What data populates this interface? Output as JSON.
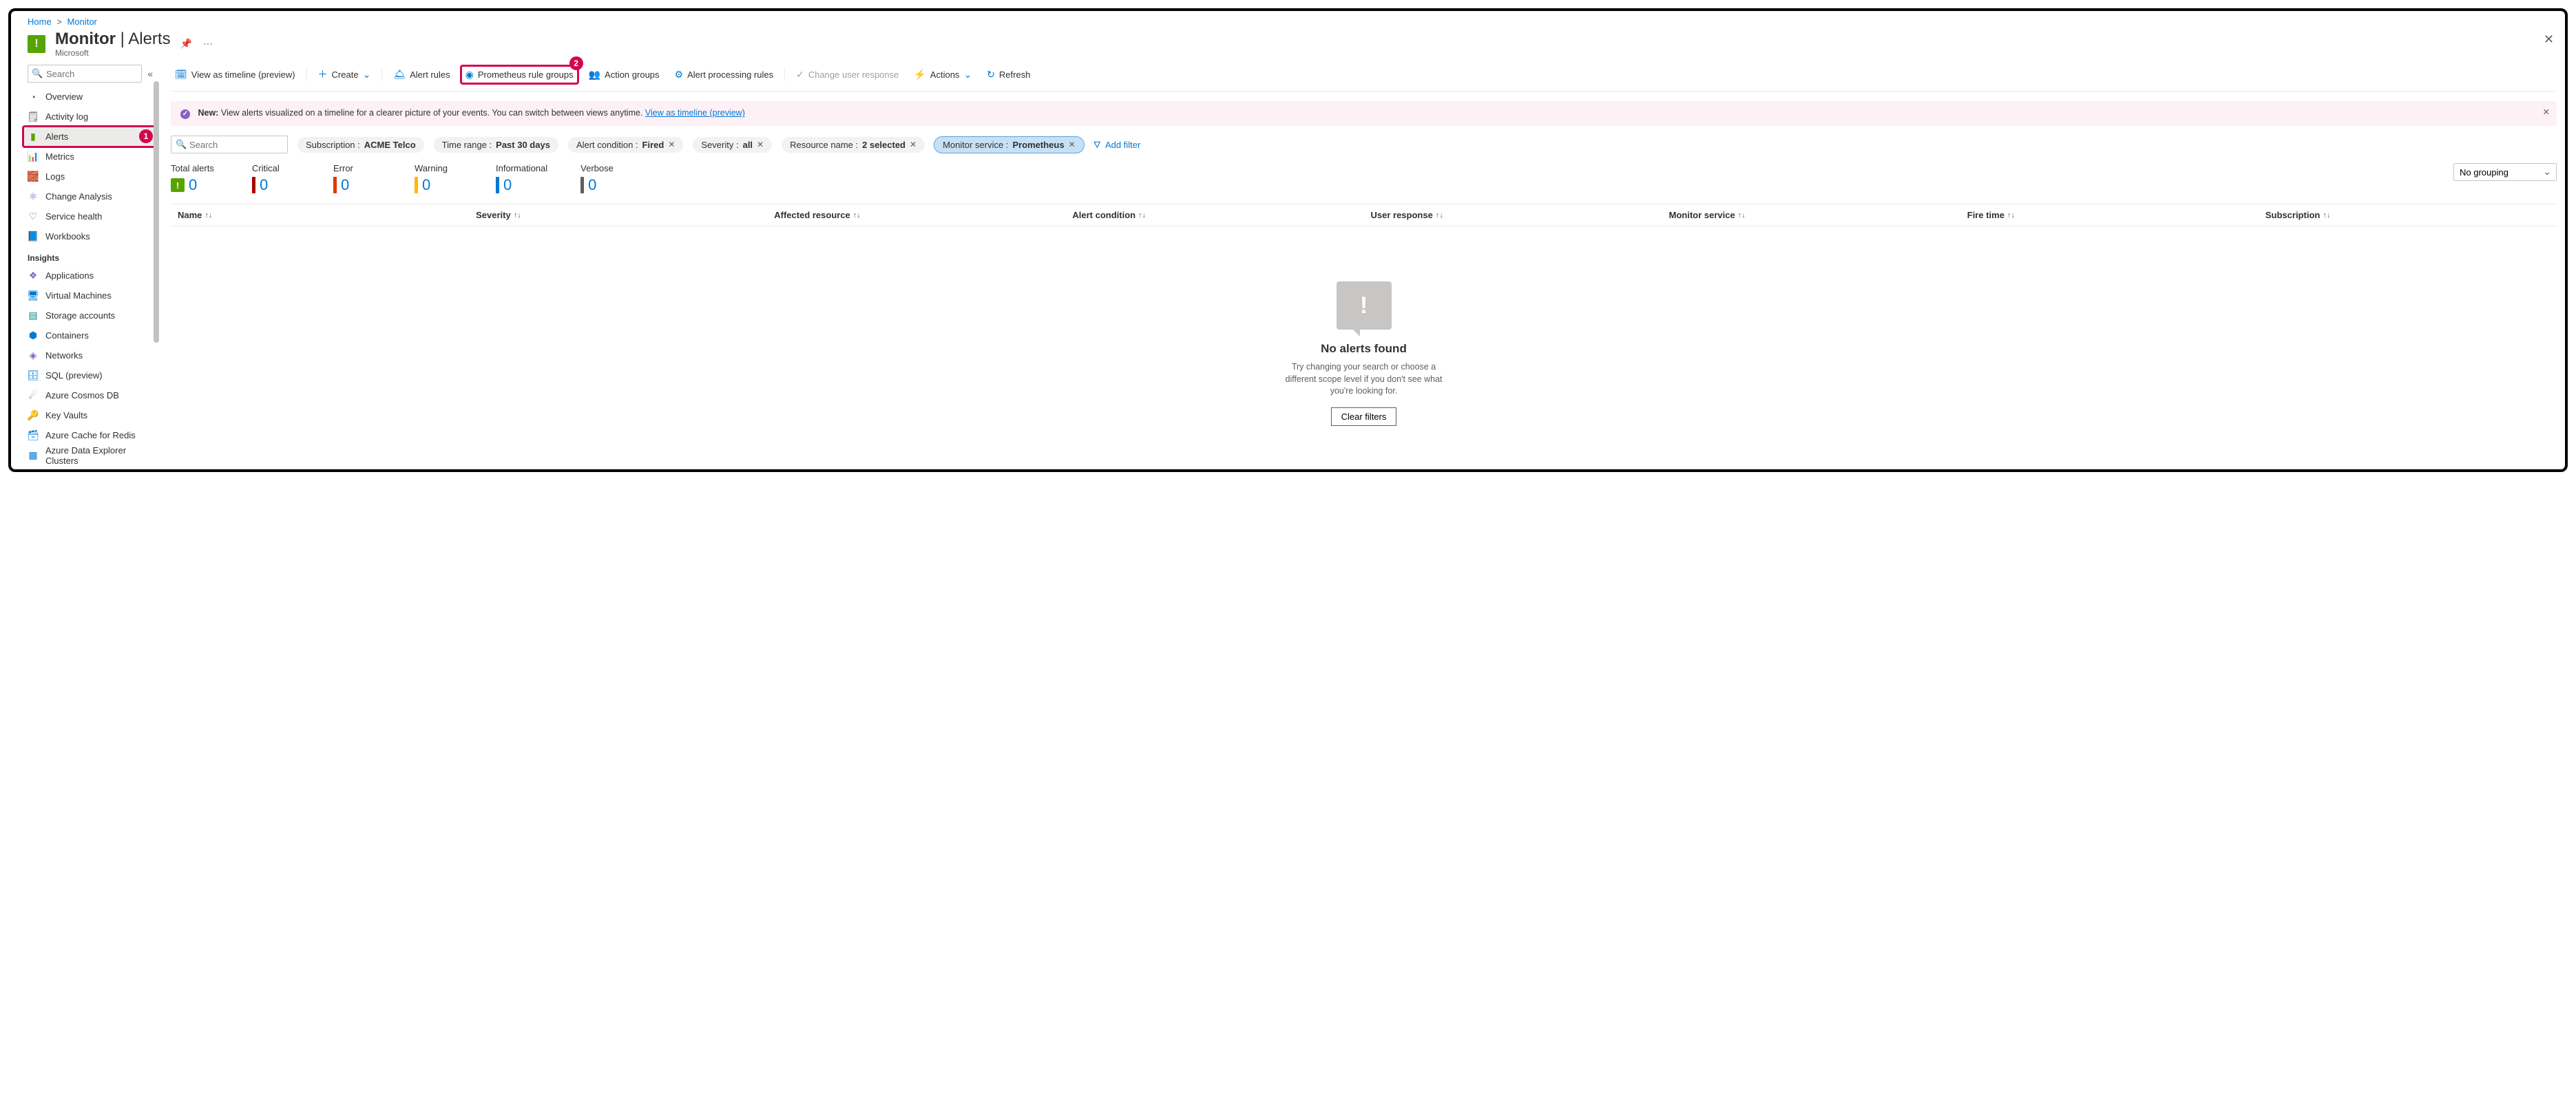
{
  "breadcrumbs": {
    "home": "Home",
    "monitor": "Monitor"
  },
  "header": {
    "title_main": "Monitor",
    "title_sep": " | ",
    "title_sub": "Alerts",
    "subtitle": "Microsoft",
    "pin_tip": "Pin",
    "more_tip": "..."
  },
  "sidebar": {
    "search_placeholder": "Search",
    "items_top": [
      {
        "label": "Overview",
        "icon": "◔",
        "cls": "c-grey"
      },
      {
        "label": "Activity log",
        "icon": "🗒",
        "cls": "c-grey"
      },
      {
        "label": "Alerts",
        "icon": "▮",
        "cls": "c-green",
        "active": true
      },
      {
        "label": "Metrics",
        "icon": "📊",
        "cls": "c-blue"
      },
      {
        "label": "Logs",
        "icon": "🧱",
        "cls": "c-orange"
      },
      {
        "label": "Change Analysis",
        "icon": "⚛",
        "cls": "c-purple"
      },
      {
        "label": "Service health",
        "icon": "♡",
        "cls": "c-grey"
      },
      {
        "label": "Workbooks",
        "icon": "📘",
        "cls": "c-blue"
      }
    ],
    "group_label": "Insights",
    "items_insights": [
      {
        "label": "Applications",
        "icon": "❖",
        "cls": "c-purple"
      },
      {
        "label": "Virtual Machines",
        "icon": "🖥",
        "cls": "c-blue"
      },
      {
        "label": "Storage accounts",
        "icon": "▤",
        "cls": "c-teal"
      },
      {
        "label": "Containers",
        "icon": "⬢",
        "cls": "c-blue"
      },
      {
        "label": "Networks",
        "icon": "◈",
        "cls": "c-purple"
      },
      {
        "label": "SQL (preview)",
        "icon": "🗄",
        "cls": "c-blue"
      },
      {
        "label": "Azure Cosmos DB",
        "icon": "☄",
        "cls": "c-blue"
      },
      {
        "label": "Key Vaults",
        "icon": "🔑",
        "cls": "c-yellow"
      },
      {
        "label": "Azure Cache for Redis",
        "icon": "🗃",
        "cls": "c-blue"
      },
      {
        "label": "Azure Data Explorer Clusters",
        "icon": "▦",
        "cls": "c-blue"
      }
    ]
  },
  "toolbar": {
    "view_timeline": "View as timeline (preview)",
    "create": "Create",
    "alert_rules": "Alert rules",
    "prom_groups": "Prometheus rule groups",
    "action_groups": "Action groups",
    "alert_proc": "Alert processing rules",
    "change_user": "Change user response",
    "actions": "Actions",
    "refresh": "Refresh"
  },
  "banner": {
    "badge": "✓",
    "lead": "New:",
    "text": " View alerts visualized on a timeline for a clearer picture of your events. You can switch between views anytime. ",
    "link": "View as timeline (preview)"
  },
  "filters": {
    "search_placeholder": "Search",
    "sub_k": "Subscription : ",
    "sub_v": "ACME Telco",
    "time_k": "Time range : ",
    "time_v": "Past 30 days",
    "cond_k": "Alert condition : ",
    "cond_v": "Fired",
    "sev_k": "Severity : ",
    "sev_v": "all",
    "res_k": "Resource name : ",
    "res_v": "2 selected",
    "mon_k": "Monitor service : ",
    "mon_v": "Prometheus",
    "add": "Add filter"
  },
  "summary": {
    "grouping": "No grouping",
    "cards": [
      {
        "label": "Total alerts",
        "value": "0",
        "kind": "total"
      },
      {
        "label": "Critical",
        "value": "0",
        "color": "#a80000"
      },
      {
        "label": "Error",
        "value": "0",
        "color": "#d83b01"
      },
      {
        "label": "Warning",
        "value": "0",
        "color": "#ffb900"
      },
      {
        "label": "Informational",
        "value": "0",
        "color": "#0078d4"
      },
      {
        "label": "Verbose",
        "value": "0",
        "color": "#605e5c"
      }
    ]
  },
  "columns": [
    "Name",
    "Severity",
    "Affected resource",
    "Alert condition",
    "User response",
    "Monitor service",
    "Fire time",
    "Subscription"
  ],
  "empty": {
    "title": "No alerts found",
    "msg": "Try changing your search or choose a different scope level if you don't see what you're looking for.",
    "btn": "Clear filters"
  },
  "callouts": {
    "one": "1",
    "two": "2"
  }
}
